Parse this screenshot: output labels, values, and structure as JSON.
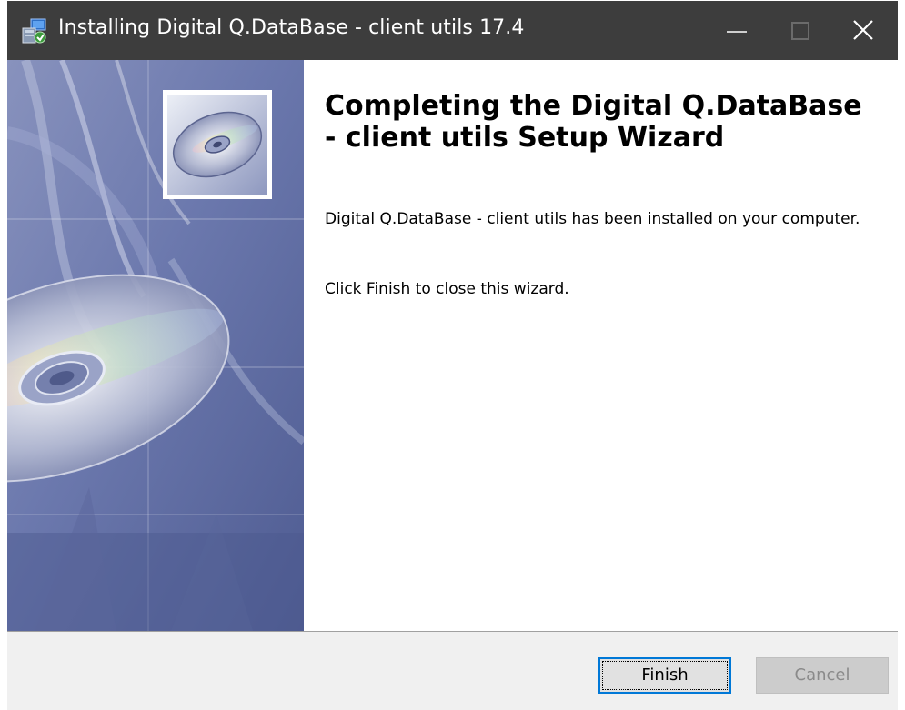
{
  "window": {
    "title": "Installing Digital Q.DataBase - client utils 17.4"
  },
  "titlebar": {
    "icons": [
      "installer-app-icon",
      "minimize-icon",
      "maximize-icon",
      "close-icon"
    ]
  },
  "main": {
    "heading": "Completing the Digital Q.DataBase - client utils Setup Wizard",
    "paragraph_1": "Digital Q.DataBase - client utils has been installed on your computer.",
    "paragraph_2": "Click Finish to close this wizard."
  },
  "footer": {
    "finish_label": "Finish",
    "cancel_label": "Cancel"
  },
  "colors": {
    "titlebar_bg": "#3d3d3d",
    "focus_blue": "#0078d7",
    "banner_blue": "#6c79a8"
  }
}
